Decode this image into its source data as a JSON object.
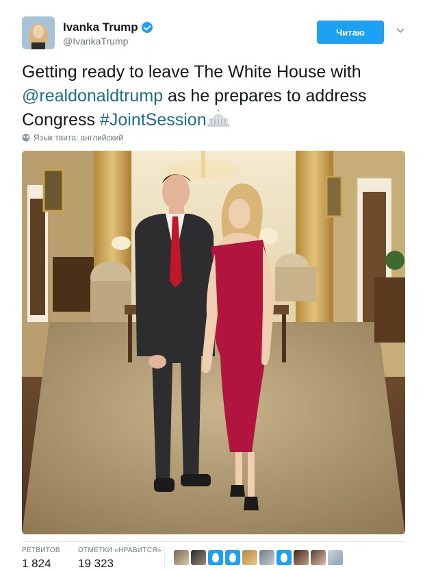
{
  "author": {
    "name": "Ivanka Trump",
    "handle": "@IvankaTrump"
  },
  "follow_button_label": "Читаю",
  "tweet": {
    "text_start": "Getting ready to leave The White House with",
    "mention": "@realdonaldtrump",
    "text_middle": "as he prepares to address Congress",
    "hashtag": "#JointSession",
    "emoji_icon": "classical-building-icon"
  },
  "language_note": "Язык твита: английский",
  "stats": {
    "retweets_label": "РЕТВИТОВ",
    "retweets_value": "1 824",
    "likes_label": "ОТМЕТКИ «НРАВИТСЯ»",
    "likes_value": "19 323"
  },
  "liker_avatars": [
    "photo",
    "photo",
    "egg",
    "egg",
    "photo",
    "photo",
    "egg",
    "photo",
    "photo",
    "photo"
  ],
  "colors": {
    "accent": "#1da1f2",
    "link": "#1b6f88",
    "dress": "#b0143f"
  }
}
